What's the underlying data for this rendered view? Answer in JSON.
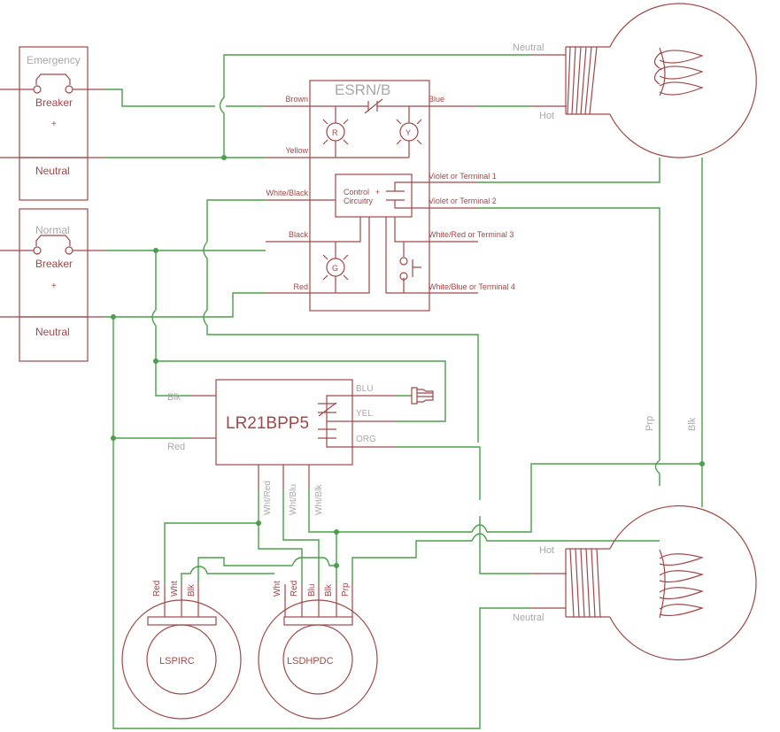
{
  "diagram": {
    "type": "wiring-schematic",
    "colors": {
      "component": "#a04848",
      "wire": "#4aa04a",
      "label": "#a8a8a8",
      "background": "#ffffff"
    },
    "breakers": [
      {
        "id": "emergency",
        "name": "Emergency",
        "label": "Breaker",
        "neutral": "Neutral"
      },
      {
        "id": "normal",
        "name": "Normal",
        "label": "Breaker",
        "neutral": "Neutral"
      }
    ],
    "esrn": {
      "name": "ESRN/B",
      "control_label_1": "Control",
      "control_label_2": "Circuitry",
      "plus": "+",
      "lamp_r": "R",
      "lamp_y": "Y",
      "lamp_g": "G",
      "left_leads": [
        "Brown",
        "Yellow",
        "White/Black",
        "Black",
        "Red"
      ],
      "right_leads": [
        "Blue",
        "Violet or Terminal 1",
        "Violet or Terminal 2",
        "White/Red or Terminal 3",
        "White/Blue or Terminal 4"
      ]
    },
    "relay": {
      "name": "LR21BPP5",
      "left_leads": [
        "Blk",
        "Red"
      ],
      "right_leads": [
        "BLU",
        "YEL",
        "ORG"
      ],
      "bottom_leads": [
        "Wht/Red",
        "Wht/Blu",
        "Wht/Blk"
      ]
    },
    "sensors": [
      {
        "name": "LSPIRC",
        "leads": [
          "Red",
          "Wht",
          "Blk"
        ]
      },
      {
        "name": "LSDHPDC",
        "leads": [
          "Wht",
          "Red",
          "Blu",
          "Blk",
          "Prp"
        ]
      }
    ],
    "lamps": [
      {
        "id": "top-lamp",
        "neutral": "Neutral",
        "hot": "Hot"
      },
      {
        "id": "bottom-lamp",
        "neutral": "Neutral",
        "hot": "Hot"
      }
    ],
    "wire_labels": {
      "prp": "Prp",
      "blk": "Blk"
    }
  }
}
